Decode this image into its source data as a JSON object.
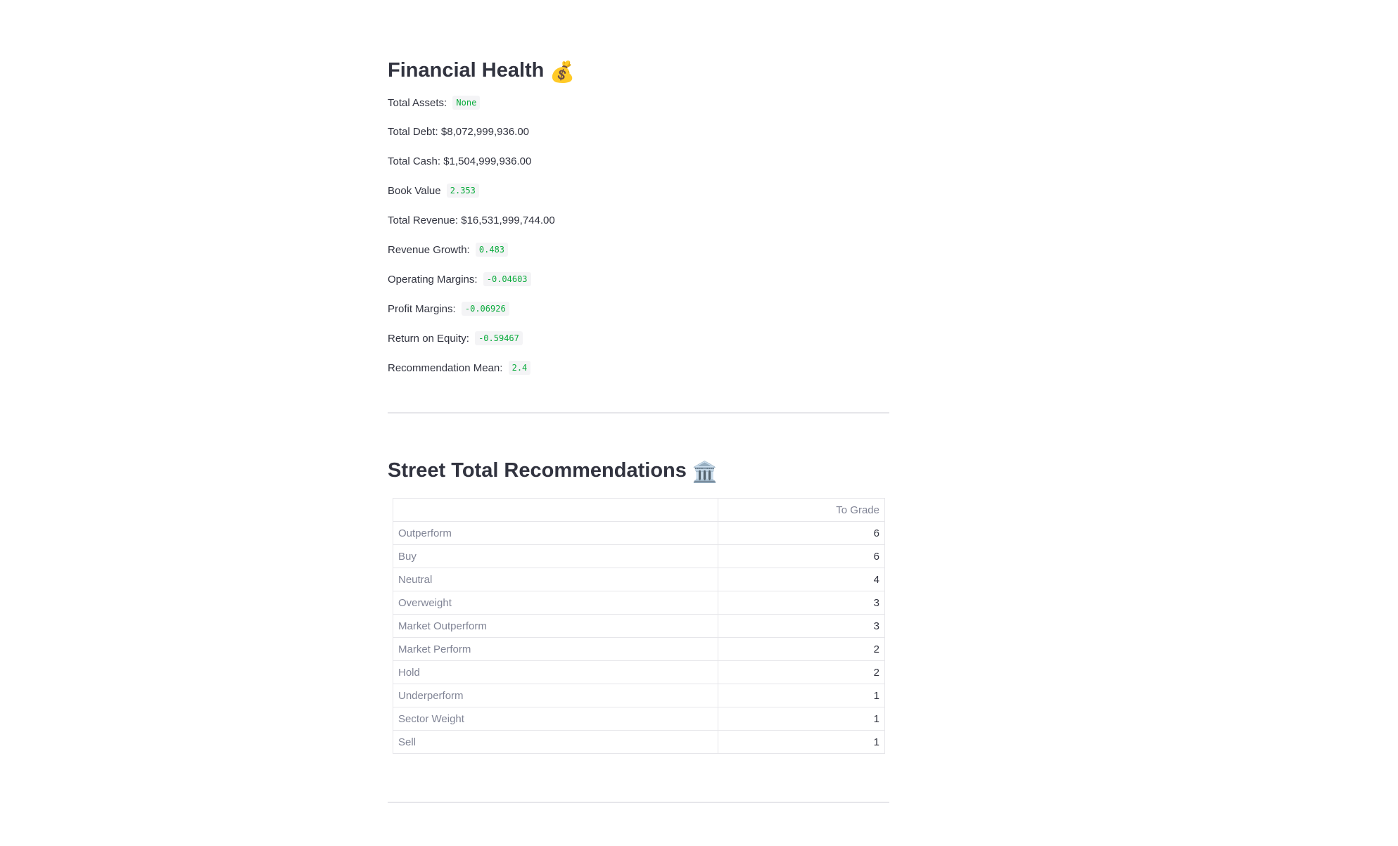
{
  "financial_health": {
    "title": "Financial Health",
    "icon": "money-bag-icon",
    "icon_glyph": "💰",
    "metrics": [
      {
        "label": "Total Assets:",
        "value": "None",
        "style": "code"
      },
      {
        "label": "Total Debt:",
        "value": "$8,072,999,936.00",
        "style": "plain"
      },
      {
        "label": "Total Cash:",
        "value": "$1,504,999,936.00",
        "style": "plain"
      },
      {
        "label": "Book Value",
        "value": "2.353",
        "style": "code"
      },
      {
        "label": "Total Revenue:",
        "value": "$16,531,999,744.00",
        "style": "plain"
      },
      {
        "label": "Revenue Growth:",
        "value": "0.483",
        "style": "code"
      },
      {
        "label": "Operating Margins:",
        "value": "-0.04603",
        "style": "code"
      },
      {
        "label": "Profit Margins:",
        "value": "-0.06926",
        "style": "code"
      },
      {
        "label": "Return on Equity:",
        "value": "-0.59467",
        "style": "code"
      },
      {
        "label": "Recommendation Mean:",
        "value": "2.4",
        "style": "code"
      }
    ]
  },
  "street_recommendations": {
    "title": "Street Total Recommendations",
    "icon": "bank-building-icon",
    "icon_glyph": "🏛️",
    "table": {
      "index_header": "",
      "column_header": "To Grade",
      "rows": [
        {
          "grade": "Outperform",
          "count": "6"
        },
        {
          "grade": "Buy",
          "count": "6"
        },
        {
          "grade": "Neutral",
          "count": "4"
        },
        {
          "grade": "Overweight",
          "count": "3"
        },
        {
          "grade": "Market Outperform",
          "count": "3"
        },
        {
          "grade": "Market Perform",
          "count": "2"
        },
        {
          "grade": "Hold",
          "count": "2"
        },
        {
          "grade": "Underperform",
          "count": "1"
        },
        {
          "grade": "Sector Weight",
          "count": "1"
        },
        {
          "grade": "Sell",
          "count": "1"
        }
      ]
    }
  },
  "colors": {
    "text": "#31333f",
    "code_text": "#09ab3b",
    "code_bg": "#f4f4f6",
    "muted_text": "#808495",
    "border": "#e6e6ea"
  }
}
